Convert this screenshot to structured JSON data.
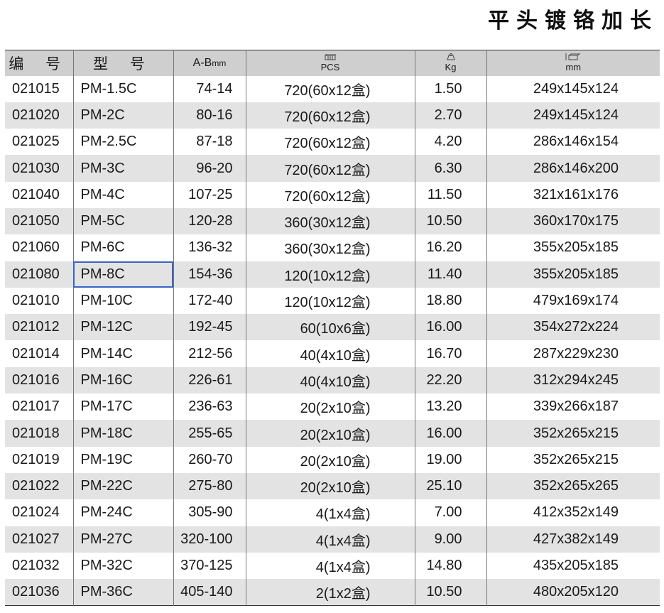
{
  "title": "平头镀铬加长",
  "headers": {
    "code": "编 号",
    "model": "型 号",
    "ab": "A-B",
    "ab_unit": "mm",
    "pcs": "PCS",
    "kg": "Kg",
    "dim": "mm"
  },
  "rows": [
    {
      "code": "021015",
      "model": "PM-1.5C",
      "ab": "74-14",
      "pcs": "720(60x12盒)",
      "kg": "1.50",
      "dim": "249x145x124"
    },
    {
      "code": "021020",
      "model": "PM-2C",
      "ab": "80-16",
      "pcs": "720(60x12盒)",
      "kg": "2.70",
      "dim": "249x145x124"
    },
    {
      "code": "021025",
      "model": "PM-2.5C",
      "ab": "87-18",
      "pcs": "720(60x12盒)",
      "kg": "4.20",
      "dim": "286x146x154"
    },
    {
      "code": "021030",
      "model": "PM-3C",
      "ab": "96-20",
      "pcs": "720(60x12盒)",
      "kg": "6.30",
      "dim": "286x146x200"
    },
    {
      "code": "021040",
      "model": "PM-4C",
      "ab": "107-25",
      "pcs": "720(60x12盒)",
      "kg": "11.50",
      "dim": "321x161x176"
    },
    {
      "code": "021050",
      "model": "PM-5C",
      "ab": "120-28",
      "pcs": "360(30x12盒)",
      "kg": "10.50",
      "dim": "360x170x175"
    },
    {
      "code": "021060",
      "model": "PM-6C",
      "ab": "136-32",
      "pcs": "360(30x12盒)",
      "kg": "16.20",
      "dim": "355x205x185"
    },
    {
      "code": "021080",
      "model": "PM-8C",
      "ab": "154-36",
      "pcs": "120(10x12盒)",
      "kg": "11.40",
      "dim": "355x205x185"
    },
    {
      "code": "021010",
      "model": "PM-10C",
      "ab": "172-40",
      "pcs": "120(10x12盒)",
      "kg": "18.80",
      "dim": "479x169x174"
    },
    {
      "code": "021012",
      "model": "PM-12C",
      "ab": "192-45",
      "pcs": "60(10x6盒)",
      "kg": "16.00",
      "dim": "354x272x224"
    },
    {
      "code": "021014",
      "model": "PM-14C",
      "ab": "212-56",
      "pcs": "40(4x10盒)",
      "kg": "16.70",
      "dim": "287x229x230"
    },
    {
      "code": "021016",
      "model": "PM-16C",
      "ab": "226-61",
      "pcs": "40(4x10盒)",
      "kg": "22.20",
      "dim": "312x294x245"
    },
    {
      "code": "021017",
      "model": "PM-17C",
      "ab": "236-63",
      "pcs": "20(2x10盒)",
      "kg": "13.20",
      "dim": "339x266x187"
    },
    {
      "code": "021018",
      "model": "PM-18C",
      "ab": "255-65",
      "pcs": "20(2x10盒)",
      "kg": "16.00",
      "dim": "352x265x215"
    },
    {
      "code": "021019",
      "model": "PM-19C",
      "ab": "260-70",
      "pcs": "20(2x10盒)",
      "kg": "19.00",
      "dim": "352x265x215"
    },
    {
      "code": "021022",
      "model": "PM-22C",
      "ab": "275-80",
      "pcs": "20(2x10盒)",
      "kg": "25.10",
      "dim": "352x265x265"
    },
    {
      "code": "021024",
      "model": "PM-24C",
      "ab": "305-90",
      "pcs": "4(1x4盒)",
      "kg": "7.00",
      "dim": "412x352x149"
    },
    {
      "code": "021027",
      "model": "PM-27C",
      "ab": "320-100",
      "pcs": "4(1x4盒)",
      "kg": "9.00",
      "dim": "427x382x149"
    },
    {
      "code": "021032",
      "model": "PM-32C",
      "ab": "370-125",
      "pcs": "4(1x4盒)",
      "kg": "14.80",
      "dim": "435x205x185"
    },
    {
      "code": "021036",
      "model": "PM-36C",
      "ab": "405-140",
      "pcs": "2(1x2盒)",
      "kg": "10.50",
      "dim": "480x205x120"
    }
  ],
  "selected_model": "PM-8C",
  "colors": {
    "header_bg": "#cfcfcf",
    "stripe_bg": "#e3e3e3",
    "selection_border": "#3a63c8"
  }
}
